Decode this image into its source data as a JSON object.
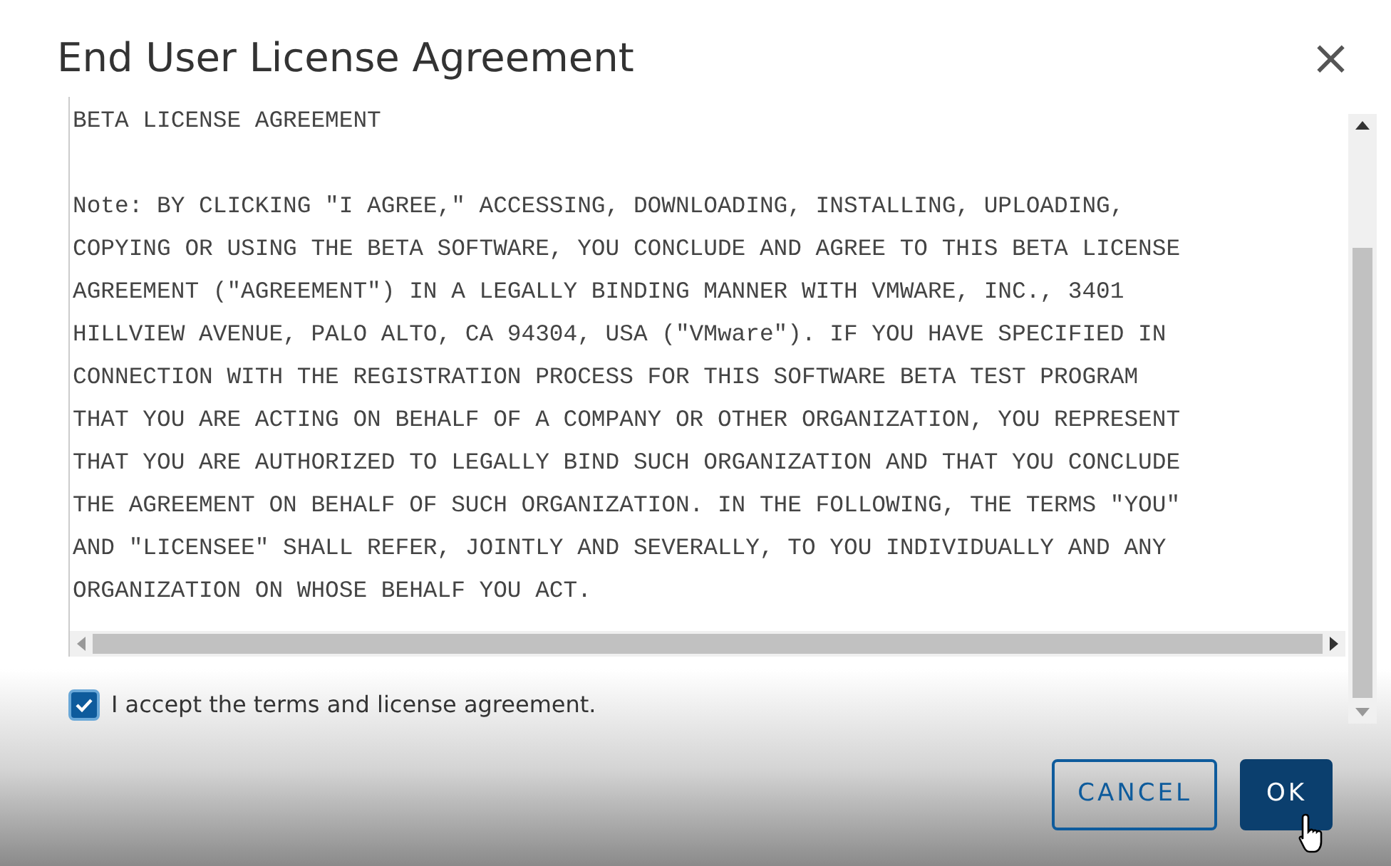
{
  "dialog": {
    "title": "End User License Agreement",
    "close": "×"
  },
  "license_paragraphs": [
    [
      "BETA LICENSE AGREEMENT"
    ],
    [
      "Note: BY CLICKING \"I AGREE,\" ACCESSING, DOWNLOADING, INSTALLING, UPLOADING,",
      "COPYING OR USING THE BETA SOFTWARE, YOU CONCLUDE AND AGREE TO THIS BETA LICENSE",
      "AGREEMENT (\"AGREEMENT\") IN A LEGALLY BINDING MANNER WITH VMWARE, INC., 3401",
      "HILLVIEW AVENUE, PALO ALTO, CA 94304, USA (\"VMware\"). IF YOU HAVE SPECIFIED IN",
      "CONNECTION WITH THE REGISTRATION PROCESS FOR THIS SOFTWARE BETA TEST PROGRAM",
      "THAT YOU ARE ACTING ON BEHALF OF A COMPANY OR OTHER ORGANIZATION, YOU REPRESENT",
      "THAT YOU ARE AUTHORIZED TO LEGALLY BIND SUCH ORGANIZATION AND THAT YOU CONCLUDE",
      "THE AGREEMENT ON BEHALF OF SUCH ORGANIZATION. IN THE FOLLOWING, THE TERMS \"YOU\"",
      "AND \"LICENSEE\" SHALL REFER, JOINTLY AND SEVERALLY, TO YOU INDIVIDUALLY AND ANY",
      "ORGANIZATION ON WHOSE BEHALF YOU ACT."
    ]
  ],
  "accept": {
    "label": "I accept the terms and license agreement.",
    "checked": true
  },
  "buttons": [
    {
      "label": "CANCEL",
      "kind": "secondary"
    },
    {
      "label": "OK",
      "kind": "primary"
    }
  ]
}
